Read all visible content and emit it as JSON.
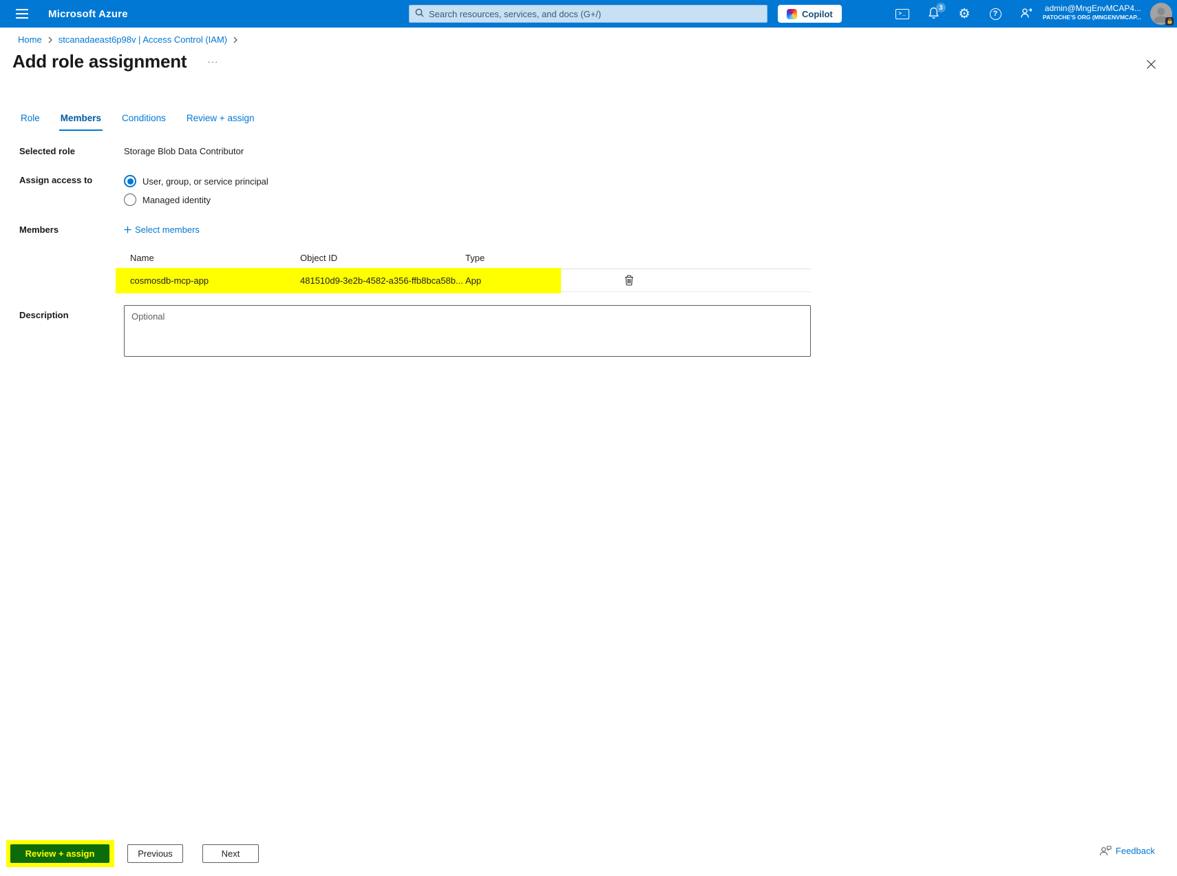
{
  "topbar": {
    "brand": "Microsoft Azure",
    "search_placeholder": "Search resources, services, and docs (G+/)",
    "copilot_label": "Copilot",
    "terminal_glyph": ">_",
    "notification_count": "3",
    "gear_glyph": "⚙",
    "help_glyph": "?",
    "account_user": "admin@MngEnvMCAP4...",
    "account_org": "PATOCHE'S ORG (MNGENVMCAP..."
  },
  "breadcrumb": {
    "home": "Home",
    "parent": "stcanadaeast6p98v | Access Control (IAM)"
  },
  "page": {
    "title": "Add role assignment",
    "more_glyph": "···"
  },
  "tabs": [
    {
      "label": "Role"
    },
    {
      "label": "Members"
    },
    {
      "label": "Conditions"
    },
    {
      "label": "Review + assign"
    }
  ],
  "form": {
    "selected_role": {
      "label": "Selected role",
      "value": "Storage Blob Data Contributor"
    },
    "assign_access": {
      "label": "Assign access to",
      "options": [
        {
          "label": "User, group, or service principal",
          "selected": true
        },
        {
          "label": "Managed identity",
          "selected": false
        }
      ]
    },
    "members": {
      "label": "Members",
      "select_link": "Select members"
    },
    "table": {
      "headers": {
        "name": "Name",
        "object_id": "Object ID",
        "type": "Type"
      },
      "row": {
        "name": "cosmosdb-mcp-app",
        "object_id": "481510d9-3e2b-4582-a356-ffb8bca58b...",
        "type": "App"
      }
    },
    "description": {
      "label": "Description",
      "placeholder": "Optional"
    }
  },
  "footer": {
    "review_assign": "Review + assign",
    "previous": "Previous",
    "next": "Next",
    "feedback": "Feedback"
  },
  "colors": {
    "accent": "#0078d4",
    "annotation_highlight": "#ffff00",
    "review_button_bg": "#0c6c0c",
    "review_button_text": "#ffff00"
  }
}
